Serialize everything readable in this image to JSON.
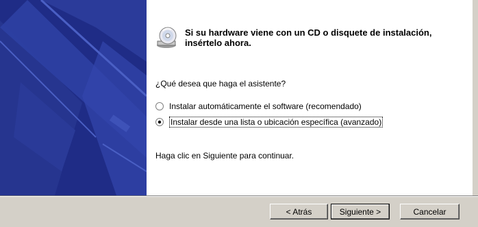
{
  "heading": "Si su hardware viene con un CD o disquete de instalación, insértelo ahora.",
  "question": "¿Qué desea que haga el asistente?",
  "options": [
    {
      "label": "Instalar automáticamente el software (recomendado)",
      "selected": false
    },
    {
      "label": "Instalar desde una lista o ubicación específica (avanzado)",
      "selected": true
    }
  ],
  "hint": "Haga clic en Siguiente para continuar.",
  "buttons": {
    "back": "< Atrás",
    "next": "Siguiente >",
    "cancel": "Cancelar"
  },
  "colors": {
    "banner": "#1f2c86",
    "face": "#d4d0c8"
  }
}
